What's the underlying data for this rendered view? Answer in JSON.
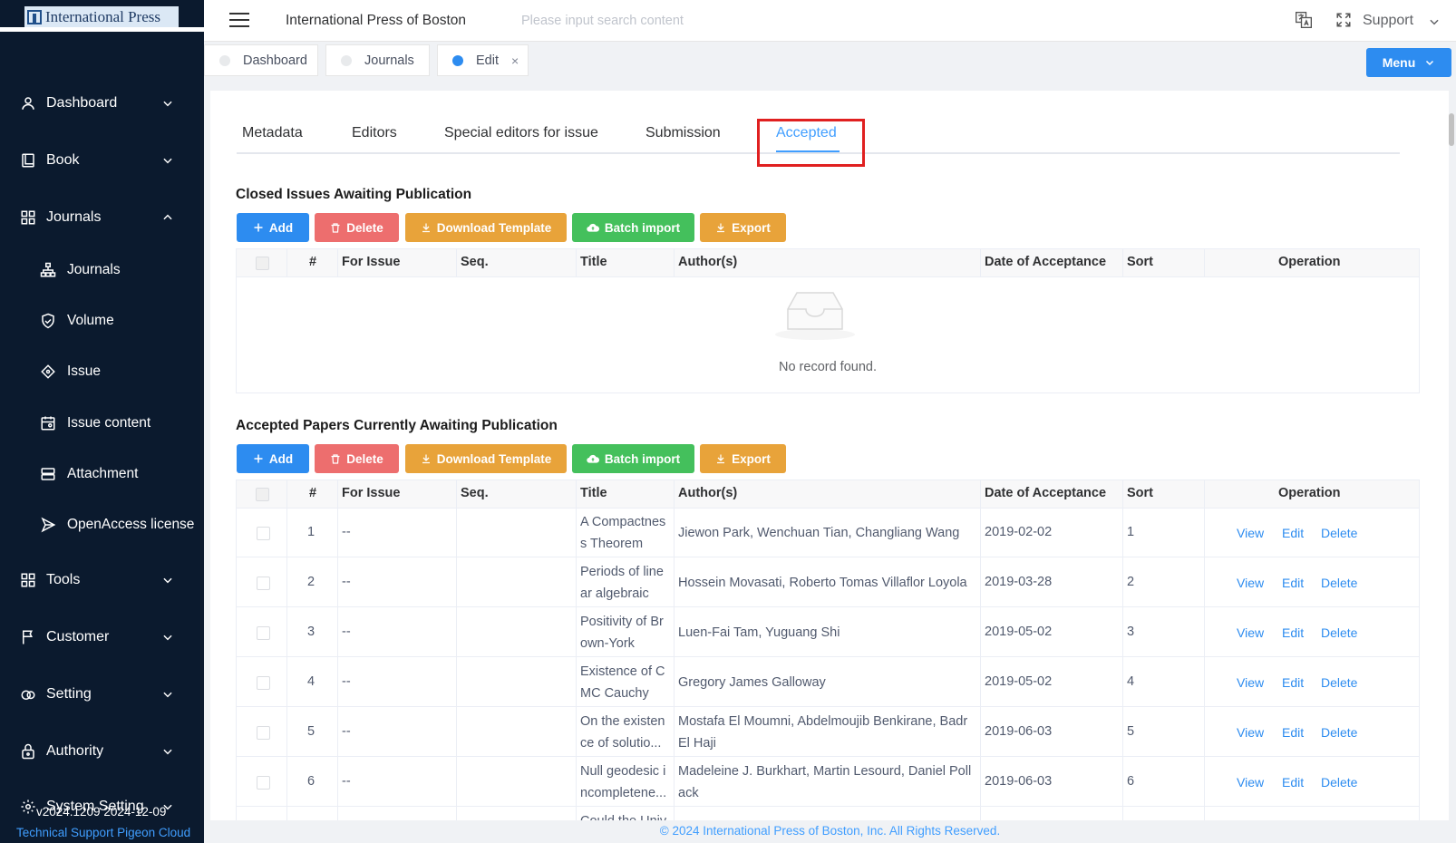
{
  "brand": {
    "logo_text": "International Press"
  },
  "sidebar": {
    "items": [
      {
        "label": "Dashboard",
        "icon": "user-icon",
        "expanded": false
      },
      {
        "label": "Book",
        "icon": "book-icon",
        "expanded": false
      },
      {
        "label": "Journals",
        "icon": "grid-icon",
        "expanded": true
      },
      {
        "label": "Tools",
        "icon": "grid-icon",
        "expanded": false
      },
      {
        "label": "Customer",
        "icon": "flag-icon",
        "expanded": false
      },
      {
        "label": "Setting",
        "icon": "link-icon",
        "expanded": false
      },
      {
        "label": "Authority",
        "icon": "lock-icon",
        "expanded": false
      },
      {
        "label": "System Setting",
        "icon": "gear-icon",
        "expanded": false
      }
    ],
    "sub_items": [
      {
        "label": "Journals",
        "icon": "sitemap-icon"
      },
      {
        "label": "Volume",
        "icon": "shield-icon"
      },
      {
        "label": "Issue",
        "icon": "diamond-icon"
      },
      {
        "label": "Issue content",
        "icon": "calendar-icon"
      },
      {
        "label": "Attachment",
        "icon": "layers-icon"
      },
      {
        "label": "OpenAccess license",
        "icon": "send-icon"
      }
    ],
    "version": "v2024.1209 2024-12-09",
    "tech_support": "Technical Support Pigeon Cloud"
  },
  "header": {
    "title": "International Press of Boston",
    "search_placeholder": "Please input search content",
    "support_label": "Support"
  },
  "tags": [
    {
      "label": "Dashboard",
      "active": false
    },
    {
      "label": "Journals",
      "active": false
    },
    {
      "label": "Edit",
      "active": true,
      "close": "×"
    }
  ],
  "menu_button": "Menu",
  "tabs": [
    {
      "label": "Metadata"
    },
    {
      "label": "Editors"
    },
    {
      "label": "Special editors for issue"
    },
    {
      "label": "Submission"
    },
    {
      "label": "Accepted",
      "active": true
    }
  ],
  "toolbar": {
    "add": "Add",
    "delete": "Delete",
    "download_template": "Download Template",
    "batch_import": "Batch import",
    "export": "Export"
  },
  "columns": [
    "#",
    "For Issue",
    "Seq.",
    "Title",
    "Author(s)",
    "Date of Acceptance",
    "Sort",
    "Operation"
  ],
  "closed_issues": {
    "title": "Closed Issues Awaiting Publication",
    "empty_text": "No record found."
  },
  "accepted_papers": {
    "title": "Accepted Papers Currently Awaiting Publication",
    "rows": [
      {
        "num": "1",
        "issue": "--",
        "seq": "",
        "title": "A Compactnes s Theorem fo...",
        "authors": "Jiewon Park, Wenchuan Tian, Changliang Wang",
        "date": "2019-02-02",
        "sort": "1"
      },
      {
        "num": "2",
        "issue": "--",
        "seq": "",
        "title": "Periods of line ar algebraic c...",
        "authors": "Hossein Movasati, Roberto Tomas Villaflor Loyola",
        "date": "2019-03-28",
        "sort": "2"
      },
      {
        "num": "3",
        "issue": "--",
        "seq": "",
        "title": "Positivity of Br own-York ma...",
        "authors": "Luen-Fai Tam, Yuguang Shi",
        "date": "2019-05-02",
        "sort": "3"
      },
      {
        "num": "4",
        "issue": "--",
        "seq": "",
        "title": "Existence of C MC Cauchy s...",
        "authors": "Gregory James Galloway",
        "date": "2019-05-02",
        "sort": "4"
      },
      {
        "num": "5",
        "issue": "--",
        "seq": "",
        "title": "On the existen ce of solutio...",
        "authors": "Mostafa El Moumni, Abdelmoujib Benkirane, Badr El Haji",
        "date": "2019-06-03",
        "sort": "5"
      },
      {
        "num": "6",
        "issue": "--",
        "seq": "",
        "title": "Null geodesic i ncompletene...",
        "authors": "Madeleine J. Burkhart, Martin Lesourd, Daniel Poll ack",
        "date": "2019-06-03",
        "sort": "6"
      },
      {
        "num": "",
        "issue": "",
        "seq": "",
        "title": "Could the Univ",
        "authors": "",
        "date": "",
        "sort": ""
      }
    ],
    "ops": {
      "view": "View",
      "edit": "Edit",
      "delete": "Delete"
    }
  },
  "footer": "© 2024 International Press of Boston, Inc. All Rights Reserved.",
  "colors": {
    "primary": "#2d8cf0",
    "danger": "#ed6e6e",
    "warning": "#e8a33a",
    "success": "#44c05c",
    "sidebar": "#0b1a2e",
    "highlight": "#e02020"
  }
}
